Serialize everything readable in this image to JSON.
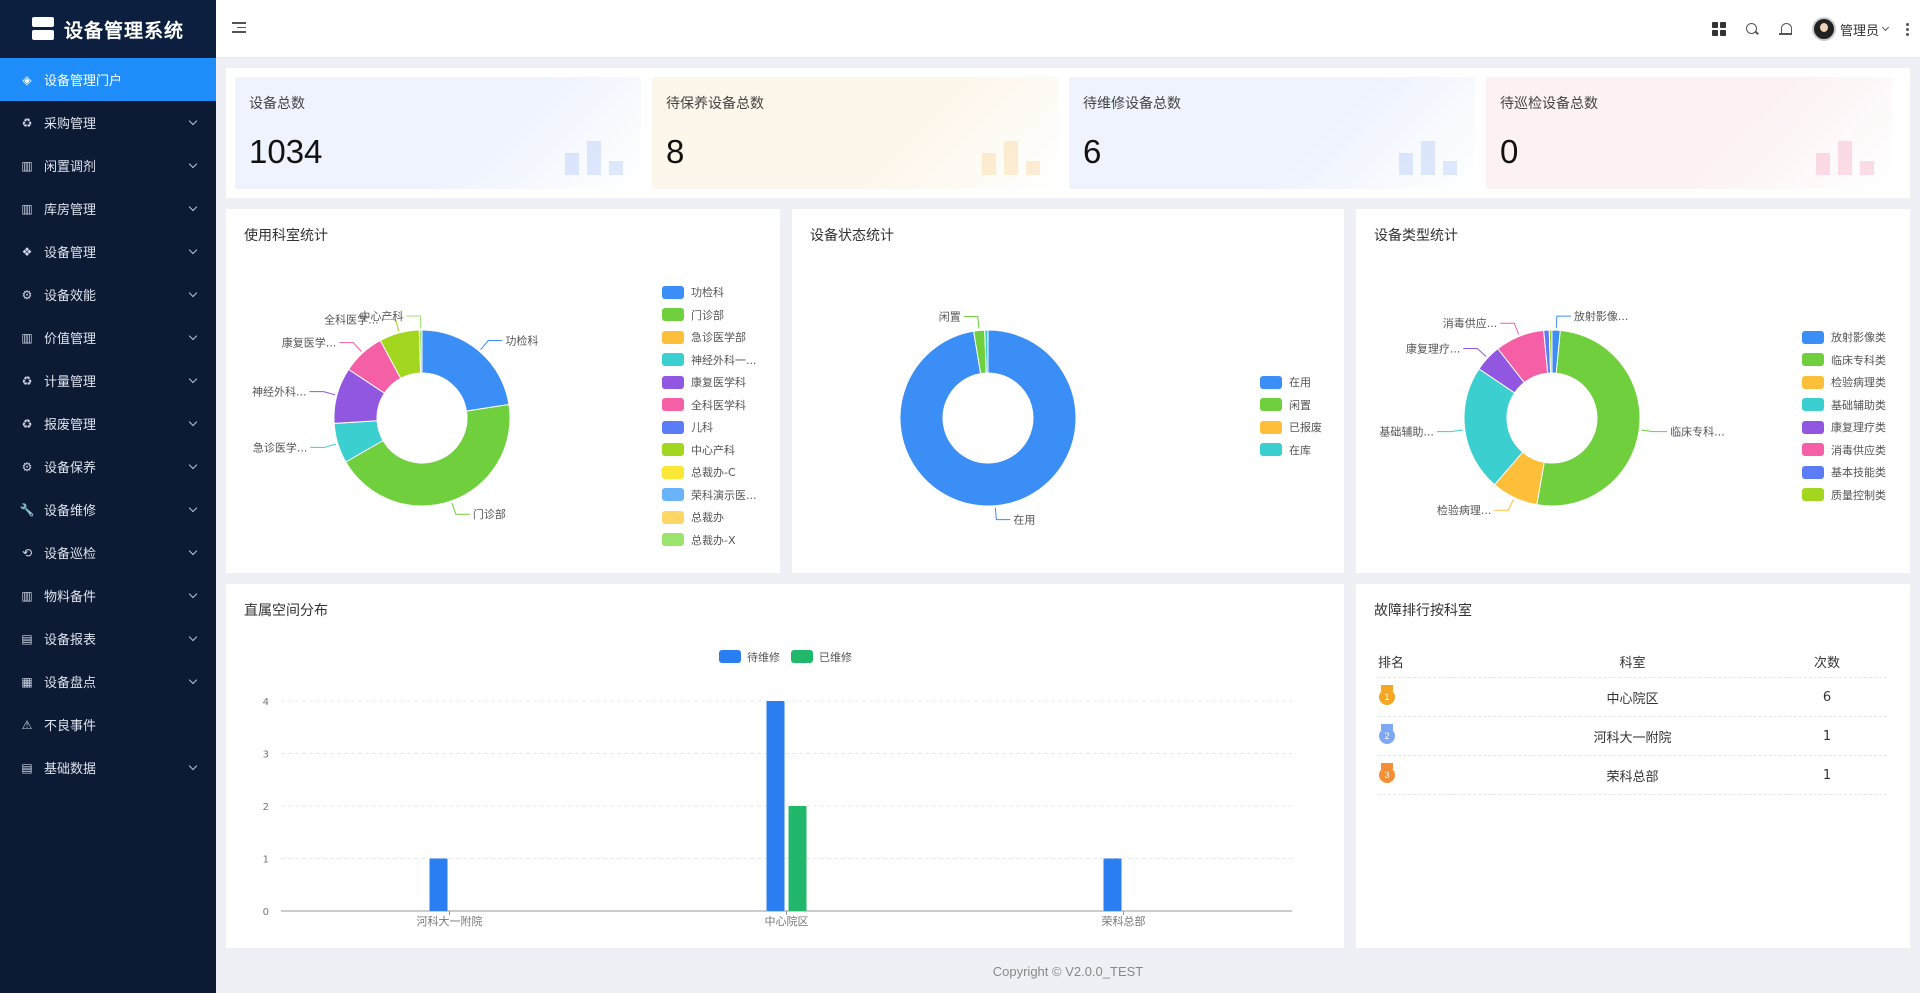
{
  "app": {
    "title": "设备管理系统"
  },
  "sidebar": {
    "items": [
      {
        "label": "设备管理门户",
        "icon": "layers-icon",
        "active": true,
        "expandable": false
      },
      {
        "label": "采购管理",
        "icon": "recycle-icon",
        "expandable": true
      },
      {
        "label": "闲置调剂",
        "icon": "columns-icon",
        "expandable": true
      },
      {
        "label": "库房管理",
        "icon": "columns-icon",
        "expandable": true
      },
      {
        "label": "设备管理",
        "icon": "apps-icon",
        "expandable": true
      },
      {
        "label": "设备效能",
        "icon": "nodes-icon",
        "expandable": true
      },
      {
        "label": "价值管理",
        "icon": "columns-icon",
        "expandable": true
      },
      {
        "label": "计量管理",
        "icon": "recycle-icon",
        "expandable": true
      },
      {
        "label": "报废管理",
        "icon": "recycle-icon",
        "expandable": true
      },
      {
        "label": "设备保养",
        "icon": "gear-box-icon",
        "expandable": true
      },
      {
        "label": "设备维修",
        "icon": "wrench-icon",
        "expandable": true
      },
      {
        "label": "设备巡检",
        "icon": "patrol-icon",
        "expandable": true
      },
      {
        "label": "物料备件",
        "icon": "barcode-icon",
        "expandable": true
      },
      {
        "label": "设备报表",
        "icon": "report-icon",
        "expandable": true
      },
      {
        "label": "设备盘点",
        "icon": "inventory-icon",
        "expandable": true
      },
      {
        "label": "不良事件",
        "icon": "warning-icon",
        "expandable": false
      },
      {
        "label": "基础数据",
        "icon": "list-icon",
        "expandable": true
      }
    ]
  },
  "header": {
    "user_name": "管理员"
  },
  "stats": [
    {
      "title": "设备总数",
      "value": "1034",
      "bg": "#eef3fd",
      "deco": "#5b8ff9"
    },
    {
      "title": "待保养设备总数",
      "value": "8",
      "bg": "#fdf6ea",
      "deco": "#f6a623"
    },
    {
      "title": "待维修设备总数",
      "value": "6",
      "bg": "#eef3fd",
      "deco": "#5b8ff9"
    },
    {
      "title": "待巡检设备总数",
      "value": "0",
      "bg": "#fcf2f4",
      "deco": "#ef4d88"
    }
  ],
  "panels": {
    "dept_title": "使用科室统计",
    "status_title": "设备状态统计",
    "type_title": "设备类型统计",
    "space_title": "直属空间分布",
    "fault_title": "故障排行按科室"
  },
  "chart_data": [
    {
      "type": "pie",
      "title": "使用科室统计",
      "labels": [
        "功检科",
        "门诊部",
        "急诊医学部",
        "神经外科一...",
        "康复医学科",
        "全科医学科",
        "儿科",
        "中心产科",
        "总裁办-C",
        "荣科演示医...",
        "总裁办",
        "总裁办-X"
      ],
      "values": [
        23,
        45,
        0,
        7.5,
        10.5,
        8,
        0,
        7.5,
        0,
        0,
        0,
        0.5
      ],
      "colors": [
        "#3a8ef6",
        "#6fcf3c",
        "#fdbf3a",
        "#3ccfcf",
        "#9257e0",
        "#f45fa6",
        "#5b7cf6",
        "#a3d61f",
        "#fde735",
        "#6ab3f8",
        "#fdd665",
        "#9be36b"
      ],
      "callouts": [
        "功检科",
        "门诊部",
        "急诊医学...",
        "神经外科...",
        "康复医学...",
        "全科医学...",
        "中心产科"
      ]
    },
    {
      "type": "pie",
      "title": "设备状态统计",
      "labels": [
        "在用",
        "闲置",
        "已报废",
        "在库"
      ],
      "values": [
        97,
        2,
        0,
        0.6
      ],
      "colors": [
        "#3a8ef6",
        "#6fcf3c",
        "#fdbf3a",
        "#3ccfcf"
      ],
      "callouts": [
        "在用",
        "闲置"
      ]
    },
    {
      "type": "pie",
      "title": "设备类型统计",
      "labels": [
        "放射影像类",
        "临床专科类",
        "检验病理类",
        "基础辅助类",
        "康复理疗类",
        "消毒供应类",
        "基本技能类",
        "质量控制类"
      ],
      "values": [
        1.5,
        51,
        8.5,
        23,
        5,
        9,
        1,
        0.5
      ],
      "colors": [
        "#3a8ef6",
        "#6fcf3c",
        "#fdbf3a",
        "#3ccfcf",
        "#9257e0",
        "#f45fa6",
        "#5b7cf6",
        "#a3d61f"
      ],
      "callouts": [
        "放射影像...",
        "临床专科...",
        "检验病理...",
        "基础辅助...",
        "康复理疗...",
        "消毒供应..."
      ]
    },
    {
      "type": "bar",
      "title": "直属空间分布",
      "categories": [
        "河科大一附院",
        "中心院区",
        "荣科总部"
      ],
      "series": [
        {
          "name": "待维修",
          "values": [
            1,
            4,
            1
          ],
          "color": "#2b7ef2"
        },
        {
          "name": "已维修",
          "values": [
            0,
            2,
            0
          ],
          "color": "#21b86b"
        }
      ],
      "ylim": [
        0,
        4
      ],
      "yticks": [
        "0",
        "1",
        "2",
        "3",
        "4"
      ]
    }
  ],
  "fault_table": {
    "headers": {
      "rank": "排名",
      "dept": "科室",
      "count": "次数"
    },
    "rows": [
      {
        "rank": "1",
        "dept": "中心院区",
        "count": "6",
        "medal": "#f5a623"
      },
      {
        "rank": "2",
        "dept": "河科大一附院",
        "count": "1",
        "medal": "#7fa8f4"
      },
      {
        "rank": "3",
        "dept": "荣科总部",
        "count": "1",
        "medal": "#f58f35"
      }
    ]
  },
  "footer": {
    "text": "Copyright © V2.0.0_TEST"
  }
}
